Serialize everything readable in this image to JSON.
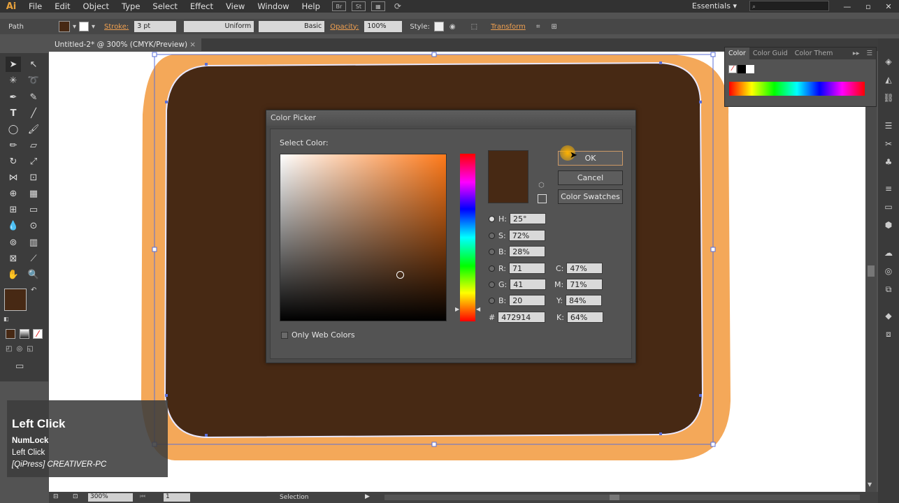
{
  "menubar": {
    "logo": "Ai",
    "items": [
      "File",
      "Edit",
      "Object",
      "Type",
      "Select",
      "Effect",
      "View",
      "Window",
      "Help"
    ],
    "bridge": "Br",
    "stock": "St",
    "workspace": "Essentials"
  },
  "control_bar": {
    "selection_type": "Path",
    "stroke_label": "Stroke:",
    "stroke_weight": "3 pt",
    "profile": "Uniform",
    "brush": "Basic",
    "opacity_label": "Opacity:",
    "opacity": "100%",
    "style_label": "Style:",
    "transform_label": "Transform",
    "fill_color": "#472914"
  },
  "document_tab": {
    "title": "Untitled-2* @ 300% (CMYK/Preview)",
    "close": "×"
  },
  "color_panel": {
    "tabs": [
      "Color",
      "Color Guid",
      "Color Them"
    ]
  },
  "artwork": {
    "outer_color": "#f4a859",
    "inner_color": "#472914",
    "tab_color": "#37bfab"
  },
  "dialog": {
    "title": "Color Picker",
    "select_color_label": "Select Color:",
    "ok": "OK",
    "cancel": "Cancel",
    "color_swatches": "Color Swatches",
    "only_web_colors": "Only Web Colors",
    "current_color": "#472914",
    "fields": {
      "H": "25°",
      "S": "72%",
      "B": "28%",
      "R": "71",
      "G": "41",
      "B2": "20",
      "C": "47%",
      "M": "71%",
      "Y": "84%",
      "K": "64%",
      "hex": "472914"
    },
    "labels": {
      "H": "H:",
      "S": "S:",
      "B": "B:",
      "R": "R:",
      "G": "G:",
      "B2": "B:",
      "C": "C:",
      "M": "M:",
      "Y": "Y:",
      "K": "K:",
      "hex": "#"
    }
  },
  "statusbar": {
    "zoom": "300%",
    "page": "1",
    "tool": "Selection"
  },
  "overlay": {
    "action": "Left Click",
    "line1": "NumLock",
    "line2": "Left Click",
    "line3": "[QiPress] CREATIVER-PC"
  }
}
